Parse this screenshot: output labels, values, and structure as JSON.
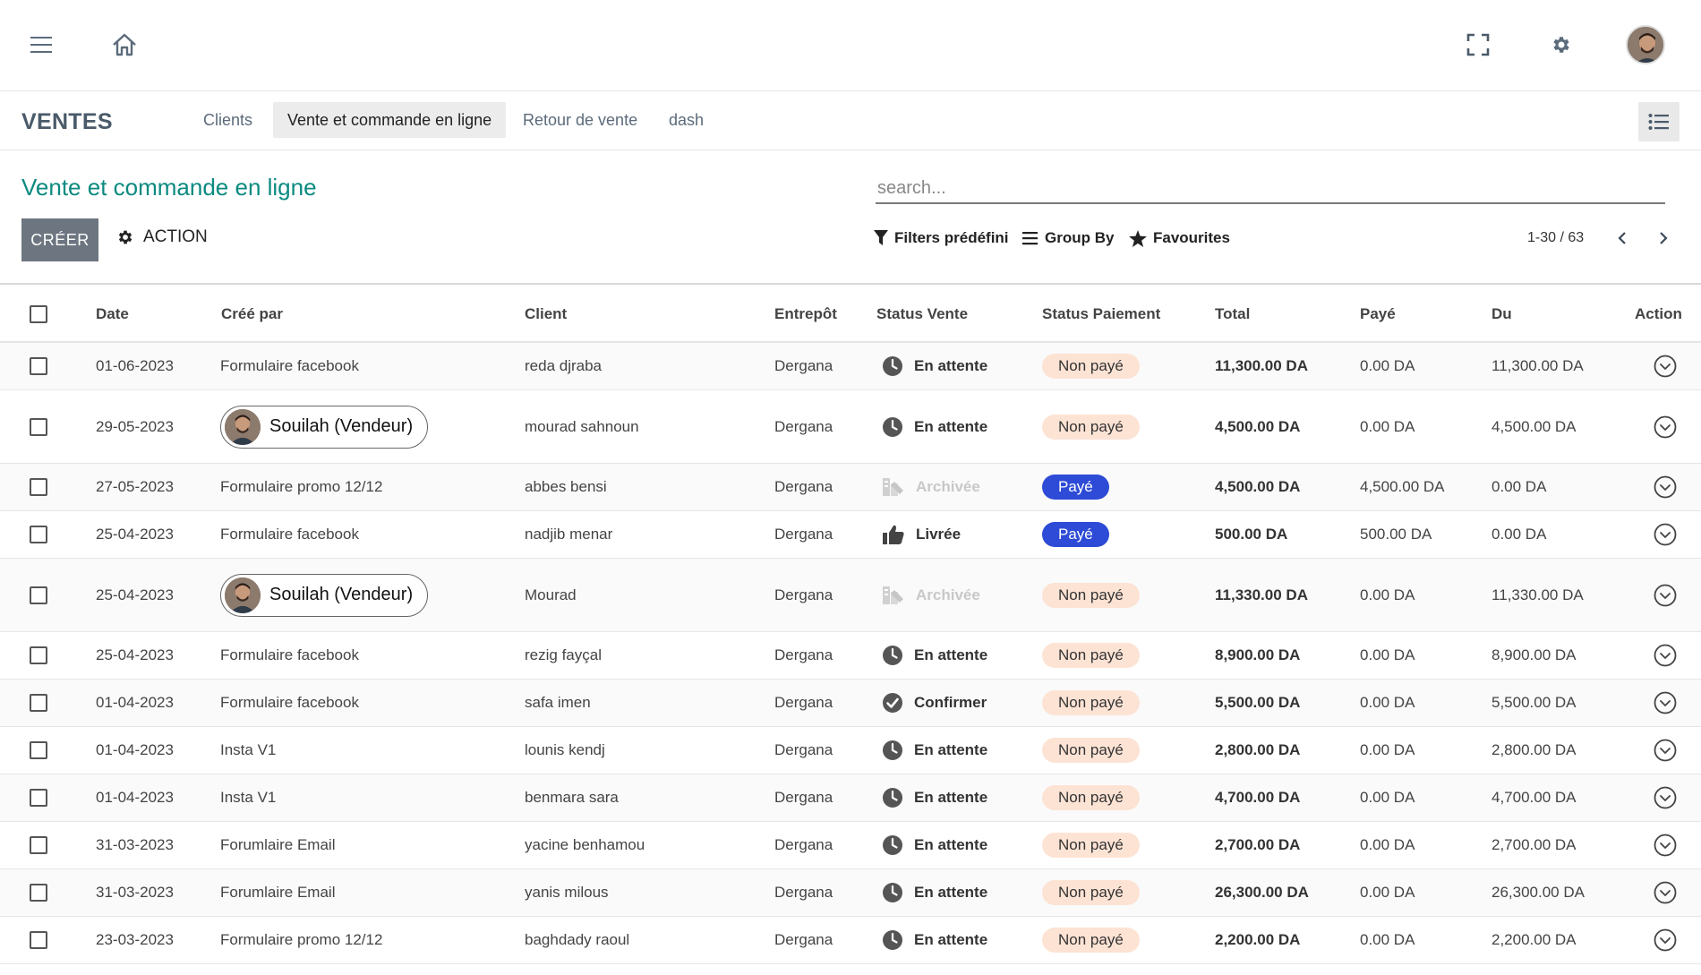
{
  "module": {
    "title": "VENTES",
    "tabs": [
      {
        "label": "Clients",
        "active": false
      },
      {
        "label": "Vente et commande en ligne",
        "active": true
      },
      {
        "label": "Retour de vente",
        "active": false
      },
      {
        "label": "dash",
        "active": false
      }
    ]
  },
  "page": {
    "title": "Vente et commande en ligne",
    "search_placeholder": "search...",
    "create_label": "CRÉER",
    "action_label": "ACTION",
    "filters_label": "Filters prédéfini",
    "groupby_label": "Group By",
    "favourites_label": "Favourites",
    "pager": "1-30 / 63"
  },
  "table": {
    "headers": {
      "date": "Date",
      "created_by": "Créé par",
      "client": "Client",
      "warehouse": "Entrepôt",
      "sale_status": "Status Vente",
      "payment_status": "Status Paiement",
      "total": "Total",
      "paid": "Payé",
      "due": "Du",
      "action": "Action"
    },
    "rows": [
      {
        "date": "01-06-2023",
        "created_by": "Formulaire facebook",
        "vendor": false,
        "client": "reda djraba",
        "warehouse": "Dergana",
        "status": "En attente",
        "status_icon": "clock-icon",
        "payment": "Non payé",
        "paid_flag": false,
        "total": "11,300.00 DA",
        "paid": "0.00 DA",
        "due": "11,300.00 DA"
      },
      {
        "date": "29-05-2023",
        "created_by": "Souilah (Vendeur)",
        "vendor": true,
        "client": "mourad sahnoun",
        "warehouse": "Dergana",
        "status": "En attente",
        "status_icon": "clock-icon",
        "payment": "Non payé",
        "paid_flag": false,
        "total": "4,500.00 DA",
        "paid": "0.00 DA",
        "due": "4,500.00 DA"
      },
      {
        "date": "27-05-2023",
        "created_by": "Formulaire promo 12/12",
        "vendor": false,
        "client": "abbes bensi",
        "warehouse": "Dergana",
        "status": "Archivée",
        "status_icon": "archive-icon",
        "payment": "Payé",
        "paid_flag": true,
        "total": "4,500.00 DA",
        "paid": "4,500.00 DA",
        "due": "0.00 DA"
      },
      {
        "date": "25-04-2023",
        "created_by": "Formulaire facebook",
        "vendor": false,
        "client": "nadjib menar",
        "warehouse": "Dergana",
        "status": "Livrée",
        "status_icon": "thumbs-up-icon",
        "payment": "Payé",
        "paid_flag": true,
        "total": "500.00 DA",
        "paid": "500.00 DA",
        "due": "0.00 DA"
      },
      {
        "date": "25-04-2023",
        "created_by": "Souilah (Vendeur)",
        "vendor": true,
        "client": "Mourad",
        "warehouse": "Dergana",
        "status": "Archivée",
        "status_icon": "archive-icon",
        "payment": "Non payé",
        "paid_flag": false,
        "total": "11,330.00 DA",
        "paid": "0.00 DA",
        "due": "11,330.00 DA"
      },
      {
        "date": "25-04-2023",
        "created_by": "Formulaire facebook",
        "vendor": false,
        "client": "rezig fayçal",
        "warehouse": "Dergana",
        "status": "En attente",
        "status_icon": "clock-icon",
        "payment": "Non payé",
        "paid_flag": false,
        "total": "8,900.00 DA",
        "paid": "0.00 DA",
        "due": "8,900.00 DA"
      },
      {
        "date": "01-04-2023",
        "created_by": "Formulaire facebook",
        "vendor": false,
        "client": "safa imen",
        "warehouse": "Dergana",
        "status": "Confirmer",
        "status_icon": "check-circle-icon",
        "payment": "Non payé",
        "paid_flag": false,
        "total": "5,500.00 DA",
        "paid": "0.00 DA",
        "due": "5,500.00 DA"
      },
      {
        "date": "01-04-2023",
        "created_by": "Insta V1",
        "vendor": false,
        "client": "lounis kendj",
        "warehouse": "Dergana",
        "status": "En attente",
        "status_icon": "clock-icon",
        "payment": "Non payé",
        "paid_flag": false,
        "total": "2,800.00 DA",
        "paid": "0.00 DA",
        "due": "2,800.00 DA"
      },
      {
        "date": "01-04-2023",
        "created_by": "Insta V1",
        "vendor": false,
        "client": "benmara sara",
        "warehouse": "Dergana",
        "status": "En attente",
        "status_icon": "clock-icon",
        "payment": "Non payé",
        "paid_flag": false,
        "total": "4,700.00 DA",
        "paid": "0.00 DA",
        "due": "4,700.00 DA"
      },
      {
        "date": "31-03-2023",
        "created_by": "Forumlaire Email",
        "vendor": false,
        "client": "yacine benhamou",
        "warehouse": "Dergana",
        "status": "En attente",
        "status_icon": "clock-icon",
        "payment": "Non payé",
        "paid_flag": false,
        "total": "2,700.00 DA",
        "paid": "0.00 DA",
        "due": "2,700.00 DA"
      },
      {
        "date": "31-03-2023",
        "created_by": "Forumlaire Email",
        "vendor": false,
        "client": "yanis milous",
        "warehouse": "Dergana",
        "status": "En attente",
        "status_icon": "clock-icon",
        "payment": "Non payé",
        "paid_flag": false,
        "total": "26,300.00 DA",
        "paid": "0.00 DA",
        "due": "26,300.00 DA"
      },
      {
        "date": "23-03-2023",
        "created_by": "Formulaire promo 12/12",
        "vendor": false,
        "client": "baghdady raoul",
        "warehouse": "Dergana",
        "status": "En attente",
        "status_icon": "clock-icon",
        "payment": "Non payé",
        "paid_flag": false,
        "total": "2,200.00 DA",
        "paid": "0.00 DA",
        "due": "2,200.00 DA"
      }
    ]
  },
  "colors": {
    "accent_title": "#0b8a80",
    "paid_badge": "#2d4bd6",
    "unpaid_badge": "#fde3d4",
    "create_button": "#6d7680"
  }
}
